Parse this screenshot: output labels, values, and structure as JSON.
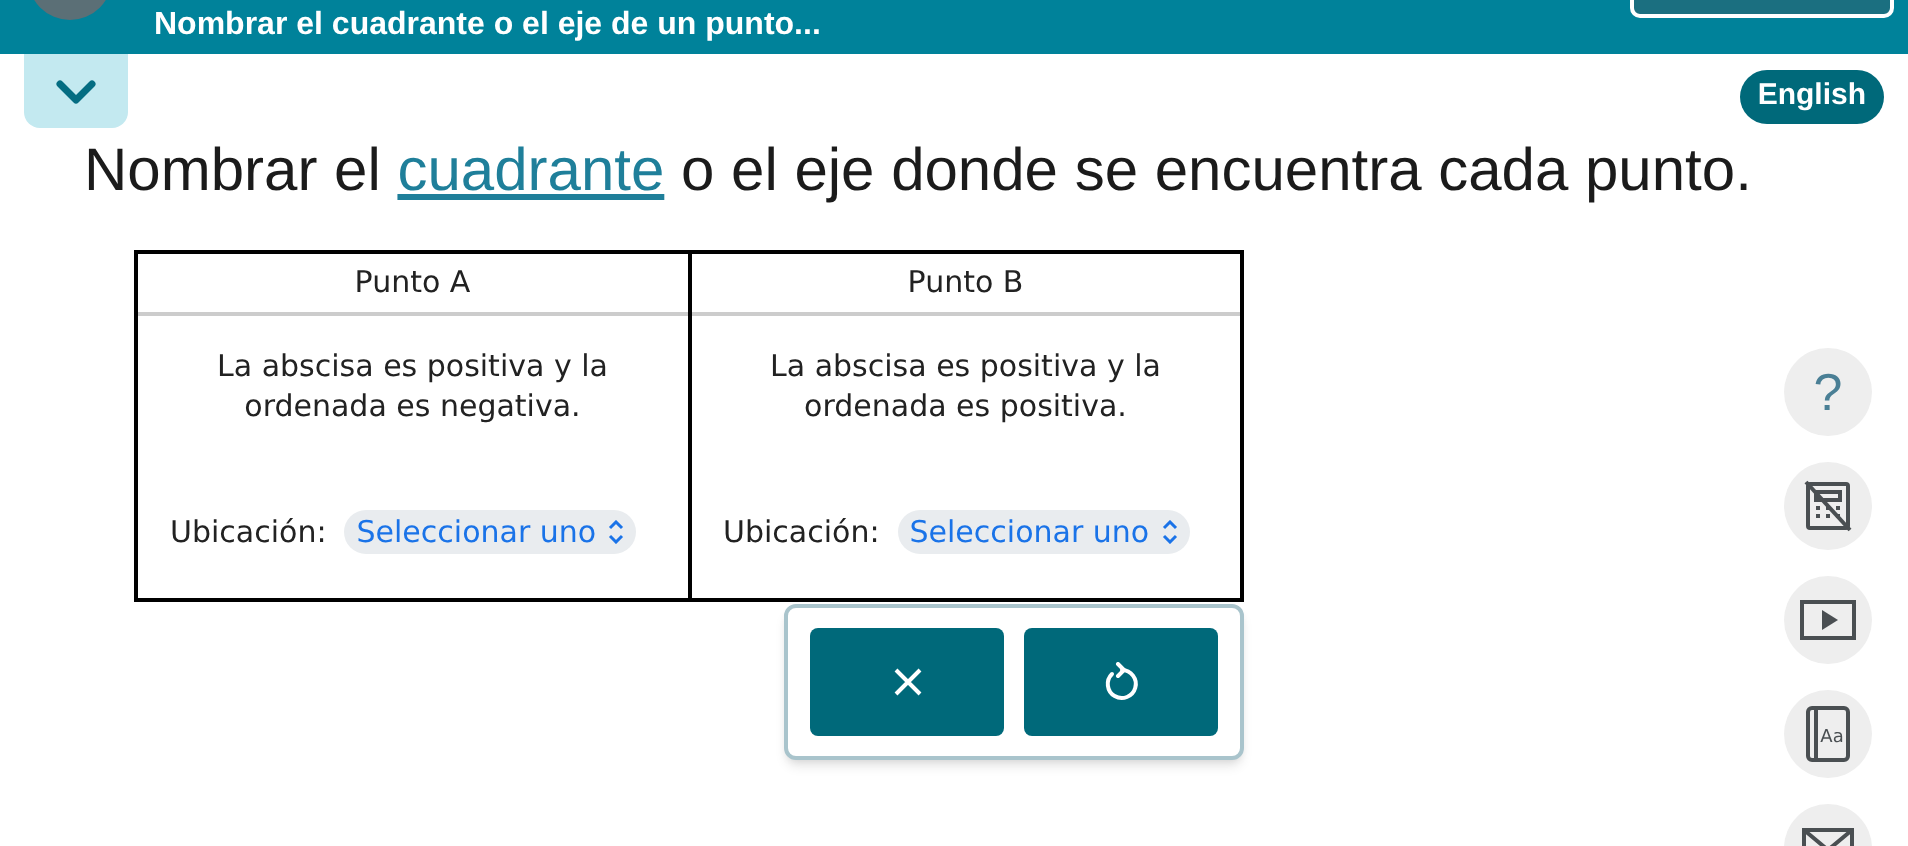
{
  "header": {
    "title": "Nombrar el cuadrante o el eje de un punto..."
  },
  "language_button": "English",
  "instruction": {
    "before": "Nombrar el ",
    "link": "cuadrante",
    "after": " o el eje donde se encuentra cada punto."
  },
  "table": {
    "columns": [
      {
        "heading": "Punto A",
        "description": "La abscisa es positiva y la ordenada es negativa.",
        "label": "Ubicación:",
        "select_value": "Seleccionar uno"
      },
      {
        "heading": "Punto B",
        "description": "La abscisa es positiva y la ordenada es positiva.",
        "label": "Ubicación:",
        "select_value": "Seleccionar uno"
      }
    ]
  },
  "tools": [
    {
      "kind": "help",
      "text": "?"
    },
    {
      "kind": "calculator"
    },
    {
      "kind": "video"
    },
    {
      "kind": "glossary",
      "text": "Aa"
    },
    {
      "kind": "mail"
    }
  ]
}
